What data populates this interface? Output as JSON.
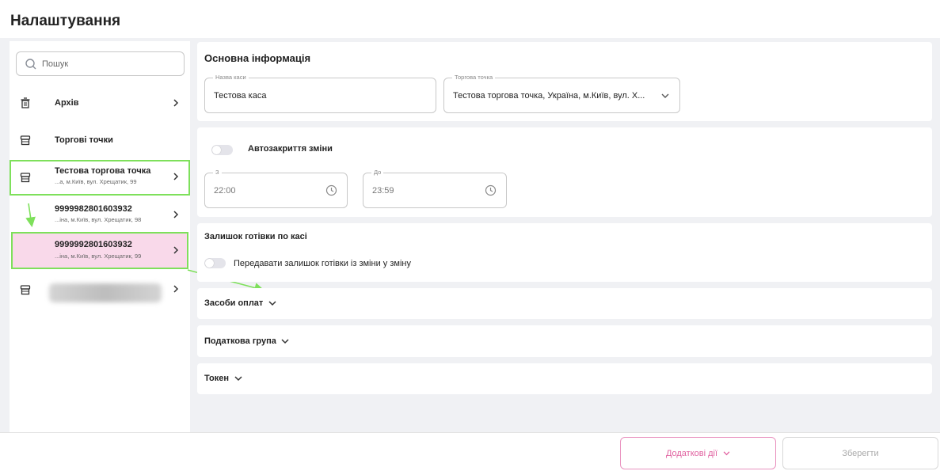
{
  "page": {
    "title": "Налаштування"
  },
  "sidebar": {
    "search_placeholder": "Пошук",
    "items": [
      {
        "label": "Архів",
        "icon": "trash-icon"
      },
      {
        "label": "Торгові точки",
        "icon": "store-icon"
      },
      {
        "label": "Тестова торгова точка",
        "sub": "...а, м.Київ, вул. Хрещатик, 99",
        "icon": "store-icon"
      },
      {
        "label": "9999982801603932",
        "sub": "...іна, м.Київ, вул. Хрещатик, 98"
      },
      {
        "label": "9999992801603932",
        "sub": "...іна, м.Київ, вул. Хрещатик, 99"
      },
      {
        "label": "",
        "icon": "store-icon"
      }
    ]
  },
  "main": {
    "basic_info": {
      "title": "Основна інформація",
      "cash_name_label": "Назва каси",
      "cash_name_value": "Тестова каса",
      "store_label": "Торгова точка",
      "store_value": "Тестова торгова точка, Україна, м.Київ, вул. Х..."
    },
    "autoclose": {
      "label": "Автозакриття зміни",
      "from_label": "З",
      "from_value": "22:00",
      "to_label": "До",
      "to_value": "23:59"
    },
    "cash_balance": {
      "title": "Залишок готівки по касі",
      "toggle_label": "Передавати залишок готівки із зміни у зміну"
    },
    "payment_methods": {
      "title": "Засоби оплат"
    },
    "tax_group": {
      "title": "Податкова група"
    },
    "token": {
      "title": "Токен"
    }
  },
  "footer": {
    "more_actions_label": "Додаткові дії",
    "save_label": "Зберегти"
  },
  "colors": {
    "highlight": "#7ee05b",
    "accent_pink": "#e0609f",
    "selected_bg": "#f9d9ea"
  }
}
